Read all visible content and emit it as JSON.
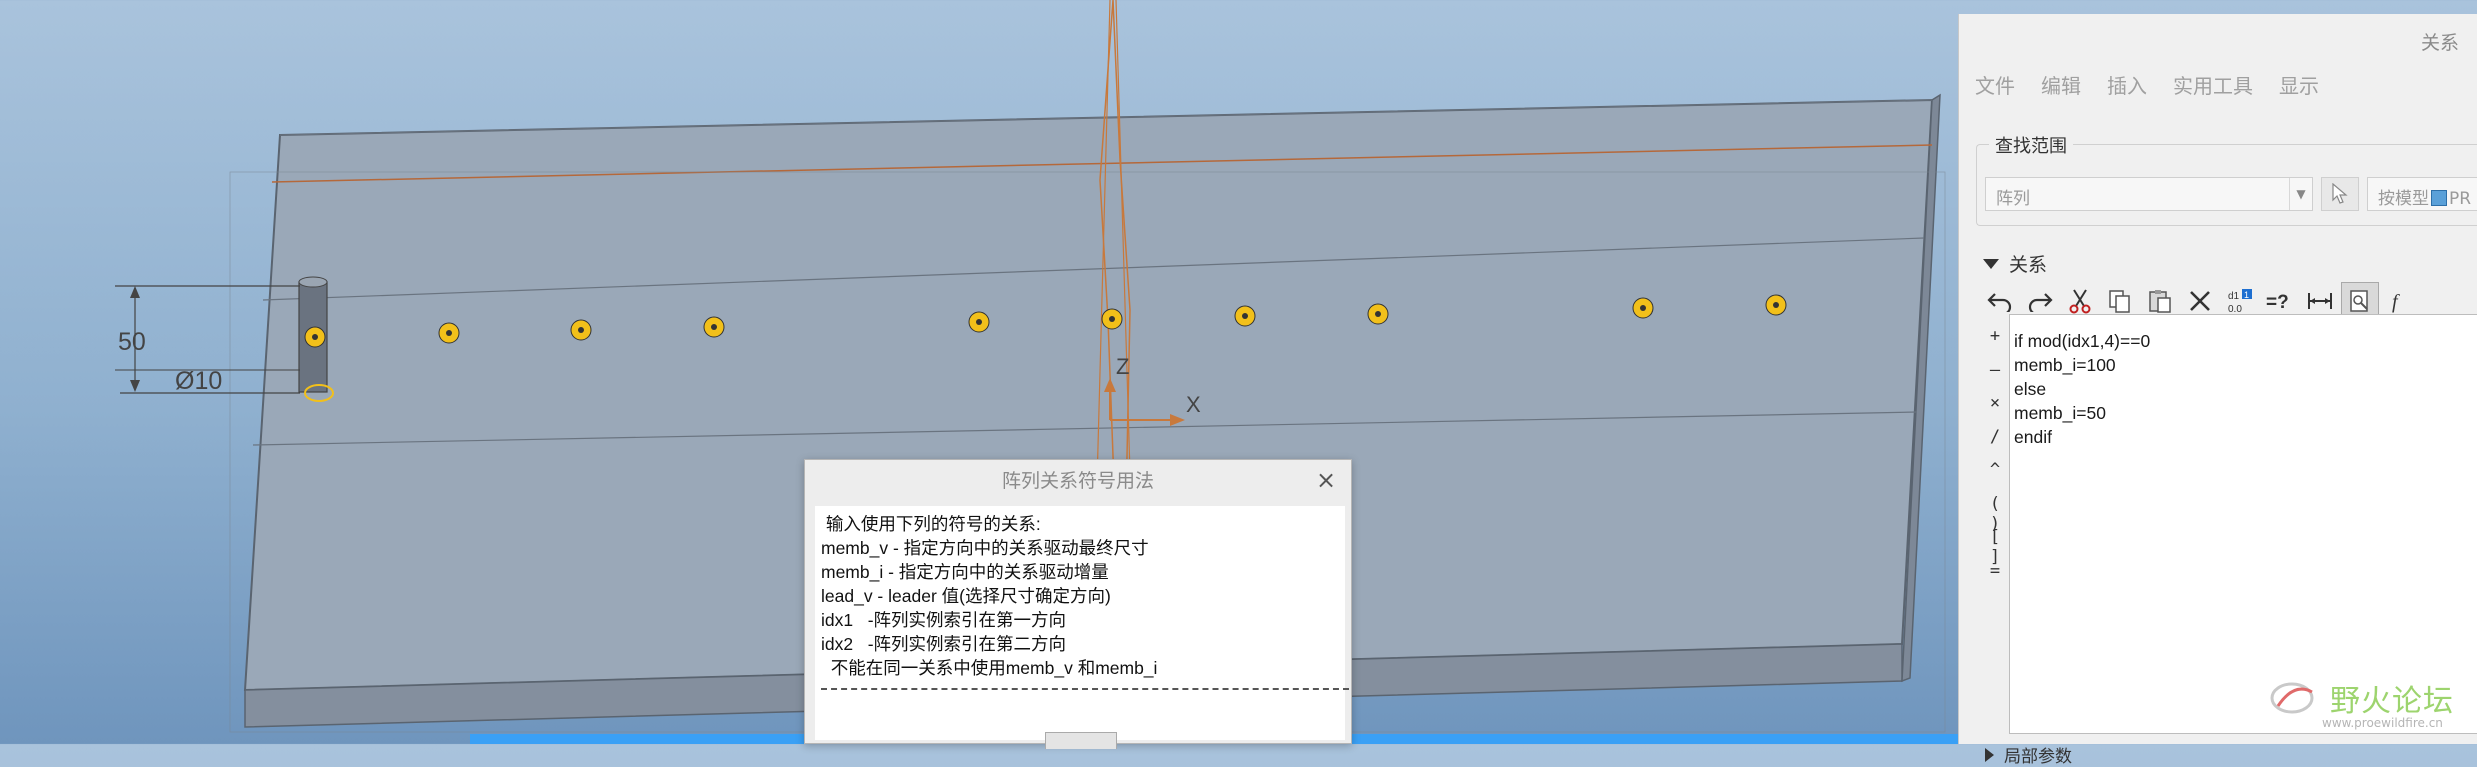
{
  "viewport": {
    "dimension_height": "50",
    "dimension_diameter": "Ø10",
    "axis_z": "Z",
    "axis_x": "X"
  },
  "relations_panel": {
    "title": "关系",
    "menu": [
      "文件",
      "编辑",
      "插入",
      "实用工具",
      "显示"
    ],
    "lookup_legend": "查找范围",
    "lookup_value": "阵列",
    "model_button_text": "按模型",
    "model_value": "PR",
    "section_label": "关系",
    "toolbar_icons": [
      "undo-icon",
      "redo-icon",
      "cut-icon",
      "copy-icon",
      "paste-icon",
      "delete-icon",
      "evaluate-icon",
      "verify-icon",
      "dimension-icon",
      "sort-icon",
      "function-icon"
    ],
    "operators": [
      "+",
      "–",
      "×",
      "/",
      "^",
      "( )",
      "[ ]",
      "="
    ],
    "code_lines": [
      "if mod(idx1,4)==0",
      "memb_i=100",
      "else",
      "memb_i=50",
      "endif"
    ],
    "local_params_label": "局部参数"
  },
  "usage_dialog": {
    "title": "阵列关系符号用法",
    "lines": [
      " 输入使用下列的符号的关系:",
      "memb_v - 指定方向中的关系驱动最终尺寸",
      "memb_i - 指定方向中的关系驱动增量",
      "lead_v - leader 值(选择尺寸确定方向)",
      "idx1   -阵列实例索引在第一方向",
      "idx2   -阵列实例索引在第二方向",
      "  不能在同一关系中使用memb_v 和memb_i"
    ]
  },
  "watermark": {
    "text": "野火论坛",
    "sub": "www.proewildfire.cn"
  },
  "colors": {
    "accent": "#3aa0f5",
    "hole_marker": "#f2c01a",
    "plate": "#9aa8b8",
    "orange_line": "#c8793c"
  }
}
